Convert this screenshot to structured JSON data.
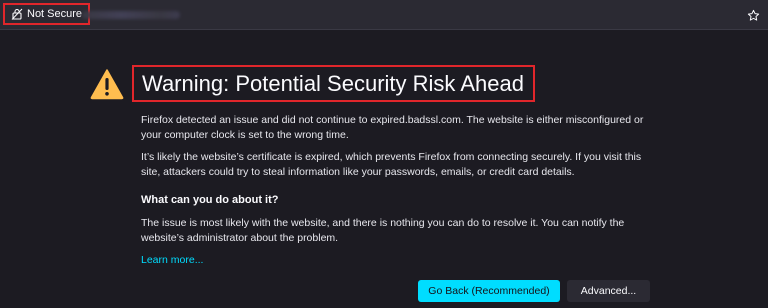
{
  "urlbar": {
    "security_label": "Not Secure",
    "lock_icon": "broken-lock-icon",
    "bookmark_icon": "star-icon"
  },
  "page": {
    "warning_icon": "warning-triangle-icon",
    "title": "Warning: Potential Security Risk Ahead",
    "paragraph_1": "Firefox detected an issue and did not continue to expired.badssl.com. The website is either misconfigured or your computer clock is set to the wrong time.",
    "paragraph_2": "It’s likely the website’s certificate is expired, which prevents Firefox from connecting securely. If you visit this site, attackers could try to steal information like your passwords, emails, or credit card details.",
    "subheading": "What can you do about it?",
    "paragraph_3": "The issue is most likely with the website, and there is nothing you can do to resolve it. You can notify the website’s administrator about the problem.",
    "learn_more": "Learn more...",
    "go_back_label": "Go Back (Recommended)",
    "advanced_label": "Advanced..."
  },
  "colors": {
    "background": "#1c1b22",
    "accent": "#00ddff",
    "warning": "#ffbd4f",
    "highlight_border": "#e1262b"
  }
}
